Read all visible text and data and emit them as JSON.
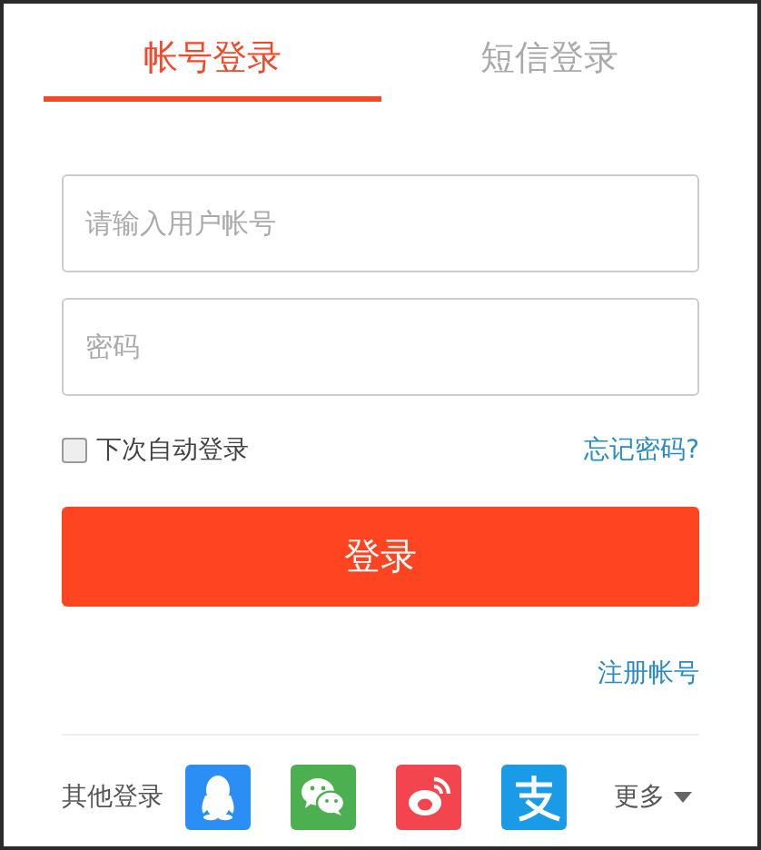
{
  "tabs": [
    {
      "label": "帐号登录",
      "selected": true
    },
    {
      "label": "短信登录",
      "selected": false
    }
  ],
  "fields": [
    {
      "placeholder": "请输入用户帐号"
    },
    {
      "placeholder": "密码"
    }
  ],
  "remember": {
    "label": "下次自动登录",
    "checked": false
  },
  "forgot_link": "忘记密码?",
  "login_button": "登录",
  "register_link": "注册帐号",
  "other_login": {
    "label": "其他登录",
    "providers": [
      {
        "kind": "qq"
      },
      {
        "kind": "wechat"
      },
      {
        "kind": "weibo"
      },
      {
        "kind": "alipay"
      }
    ],
    "more": "更多"
  }
}
